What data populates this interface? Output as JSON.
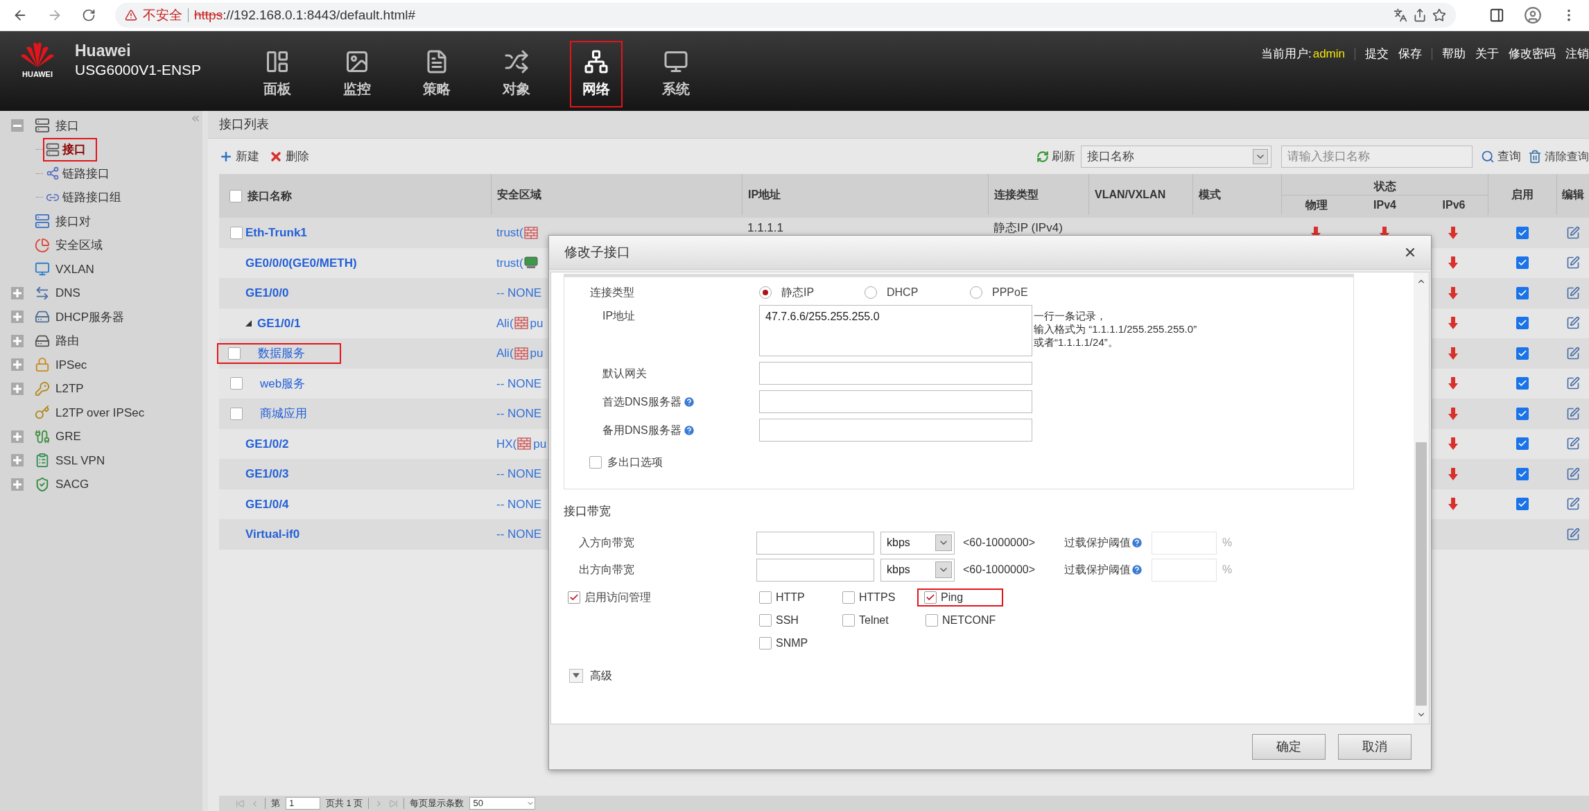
{
  "browser": {
    "insecure_label": "不安全",
    "url_scheme": "https",
    "url_rest": "://192.168.0.1:8443/default.html#"
  },
  "header": {
    "logo_caption": "HUAWEI",
    "brand": "Huawei",
    "model": "USG6000V1-ENSP",
    "nav": [
      {
        "label": "面板",
        "selected": false,
        "highlighted": false
      },
      {
        "label": "监控",
        "selected": false,
        "highlighted": false
      },
      {
        "label": "策略",
        "selected": false,
        "highlighted": false
      },
      {
        "label": "对象",
        "selected": false,
        "highlighted": false
      },
      {
        "label": "网络",
        "selected": true,
        "highlighted": true
      },
      {
        "label": "系统",
        "selected": false,
        "highlighted": false
      }
    ],
    "user_label": "当前用户:",
    "user": "admin",
    "actions": [
      "提交",
      "保存",
      "帮助",
      "关于",
      "修改密码",
      "注销"
    ]
  },
  "sidebar": {
    "items": [
      {
        "label": "接口",
        "expandable": true,
        "expanded": true,
        "children": [
          {
            "label": "接口",
            "selected": true,
            "highlighted": true
          },
          {
            "label": "链路接口",
            "selected": false,
            "highlighted": false
          },
          {
            "label": "链路接口组",
            "selected": false,
            "highlighted": false
          }
        ]
      },
      {
        "label": "接口对",
        "expandable": false
      },
      {
        "label": "安全区域",
        "expandable": false
      },
      {
        "label": "VXLAN",
        "expandable": false
      },
      {
        "label": "DNS",
        "expandable": true,
        "expanded": false
      },
      {
        "label": "DHCP服务器",
        "expandable": true,
        "expanded": false
      },
      {
        "label": "路由",
        "expandable": true,
        "expanded": false
      },
      {
        "label": "IPSec",
        "expandable": true,
        "expanded": false
      },
      {
        "label": "L2TP",
        "expandable": true,
        "expanded": false
      },
      {
        "label": "L2TP over IPSec",
        "expandable": false
      },
      {
        "label": "GRE",
        "expandable": true,
        "expanded": false
      },
      {
        "label": "SSL VPN",
        "expandable": true,
        "expanded": false
      },
      {
        "label": "SACG",
        "expandable": true,
        "expanded": false
      }
    ]
  },
  "panel": {
    "title": "接口列表",
    "toolbar": {
      "new": "新建",
      "delete": "删除",
      "refresh": "刷新",
      "filter_select": "接口名称",
      "search_placeholder": "请输入接口名称",
      "query": "查询",
      "clear": "清除查询"
    }
  },
  "table": {
    "header_checked": false,
    "columns": [
      "接口名称",
      "安全区域",
      "IP地址",
      "连接类型",
      "VLAN/VXLAN",
      "模式"
    ],
    "status_group": "状态",
    "status_columns": [
      "物理",
      "IPv4",
      "IPv6"
    ],
    "end_columns": [
      "启用",
      "编辑"
    ],
    "rows": [
      {
        "name": "Eth-Trunk1",
        "checked": false,
        "highlighted": false,
        "zone": "trust(",
        "zone_icon": {
          "kind": "brick"
        },
        "ip": "1.1.1.1",
        "conn_type": "静态IP (IPv4)",
        "status": {
          "phys_up": false,
          "ipv4_up": false,
          "ipv6_up": false
        },
        "enabled": true
      },
      {
        "name": "GE0/0/0(GE0/METH)",
        "highlighted": false,
        "zone": "trust(",
        "zone_icon": {
          "kind": "monitor"
        },
        "status": {
          "ipv6_up": false
        },
        "enabled": true
      },
      {
        "name": "GE1/0/0",
        "highlighted": false,
        "zone": "-- NONE",
        "status": {
          "ipv6_up": false
        },
        "enabled": true
      },
      {
        "name": "GE1/0/1",
        "highlighted": false,
        "zone": "Ali(",
        "zone_icon": {
          "kind": "brick"
        },
        "zone_tail": "pu",
        "status": {
          "ipv6_up": false
        },
        "enabled": true,
        "expanded": true,
        "children": [
          {
            "name": "数据服务",
            "checked": false,
            "highlighted": true,
            "zone": "Ali(",
            "zone_icon": {
              "kind": "brick"
            },
            "zone_tail": "pu",
            "status": {
              "ipv6_up": false
            },
            "enabled": true
          },
          {
            "name": "web服务",
            "checked": false,
            "highlighted": false,
            "zone": "-- NONE",
            "status": {
              "ipv6_up": false
            },
            "enabled": true
          },
          {
            "name": "商城应用",
            "checked": false,
            "highlighted": false,
            "zone": "-- NONE",
            "status": {
              "ipv6_up": false
            },
            "enabled": true
          }
        ]
      },
      {
        "name": "GE1/0/2",
        "highlighted": false,
        "zone": "HX(",
        "zone_icon": {
          "kind": "brick"
        },
        "zone_tail": "pu",
        "status": {
          "ipv6_up": false
        },
        "enabled": true
      },
      {
        "name": "GE1/0/3",
        "highlighted": false,
        "zone": "-- NONE",
        "status": {
          "ipv6_up": false
        },
        "enabled": true
      },
      {
        "name": "GE1/0/4",
        "highlighted": false,
        "zone": "-- NONE",
        "status": {
          "ipv6_up": false
        },
        "enabled": true
      },
      {
        "name": "Virtual-if0",
        "highlighted": false,
        "zone": "-- NONE",
        "status": {}
      }
    ]
  },
  "pager": {
    "page_prefix": "第",
    "page": "1",
    "page_suffix": "页共 1 页",
    "per_page_label": "每页显示条数",
    "per_page": "50"
  },
  "dialog": {
    "title": "修改子接口",
    "conn_label": "连接类型",
    "conn_options": [
      {
        "label": "静态IP",
        "selected": true
      },
      {
        "label": "DHCP",
        "selected": false
      },
      {
        "label": "PPPoE",
        "selected": false
      }
    ],
    "ip_label": "IP地址",
    "ip_value": "47.7.6.6/255.255.255.0",
    "ip_hint": [
      "一行一条记录，",
      "输入格式为 “1.1.1.1/255.255.255.0”",
      "或者“1.1.1.1/24”。"
    ],
    "fields": [
      {
        "label": "默认网关",
        "help": false
      },
      {
        "label": "首选DNS服务器",
        "help": true
      },
      {
        "label": "备用DNS服务器",
        "help": true
      }
    ],
    "multi_exit": {
      "label": "多出口选项",
      "checked": false
    },
    "bandwidth_title": "接口带宽",
    "bandwidth": [
      {
        "label": "入方向带宽",
        "unit": "kbps",
        "range": "<60-1000000>",
        "threshold_label": "过载保护阈值",
        "percent": "%"
      },
      {
        "label": "出方向带宽",
        "unit": "kbps",
        "range": "<60-1000000>",
        "threshold_label": "过载保护阈值",
        "percent": "%"
      }
    ],
    "access": {
      "label": "启用访问管理",
      "checked": true
    },
    "services": [
      {
        "label": "HTTP",
        "checked": false,
        "highlighted": false
      },
      {
        "label": "HTTPS",
        "checked": false,
        "highlighted": false
      },
      {
        "label": "Ping",
        "checked": true,
        "highlighted": true
      },
      {
        "label": "SSH",
        "checked": false,
        "highlighted": false
      },
      {
        "label": "Telnet",
        "checked": false,
        "highlighted": false
      },
      {
        "label": "NETCONF",
        "checked": false,
        "highlighted": false
      },
      {
        "label": "SNMP",
        "checked": false,
        "highlighted": false
      }
    ],
    "advanced": {
      "label": "高级",
      "expanded": false
    },
    "buttons": [
      "确定",
      "取消"
    ]
  }
}
